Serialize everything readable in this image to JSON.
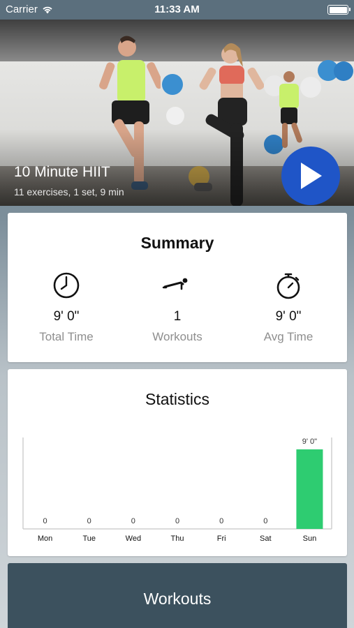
{
  "status_bar": {
    "carrier": "Carrier",
    "time": "11:33 AM",
    "icons": [
      "wifi-icon",
      "battery-icon"
    ]
  },
  "hero": {
    "title": "10 Minute HIIT",
    "subtitle": "11 exercises, 1 set, 9 min",
    "play_icon": "play-icon",
    "play_color": "#1f55c7"
  },
  "summary": {
    "title": "Summary",
    "metrics": [
      {
        "icon": "clock-icon",
        "value": "9' 0\"",
        "label": "Total Time"
      },
      {
        "icon": "pushup-icon",
        "value": "1",
        "label": "Workouts"
      },
      {
        "icon": "stopwatch-icon",
        "value": "9' 0\"",
        "label": "Avg Time"
      }
    ]
  },
  "statistics": {
    "title": "Statistics",
    "chart_data": {
      "type": "bar",
      "categories": [
        "Mon",
        "Tue",
        "Wed",
        "Thu",
        "Fri",
        "Sat",
        "Sun"
      ],
      "values": [
        0,
        0,
        0,
        0,
        0,
        0,
        9
      ],
      "value_labels": [
        "0",
        "0",
        "0",
        "0",
        "0",
        "0",
        "9' 0\""
      ],
      "ylim": [
        0,
        9
      ],
      "bar_color": "#2ecc71",
      "grid": false
    }
  },
  "workouts_button": {
    "label": "Workouts",
    "color": "#3c515e"
  }
}
